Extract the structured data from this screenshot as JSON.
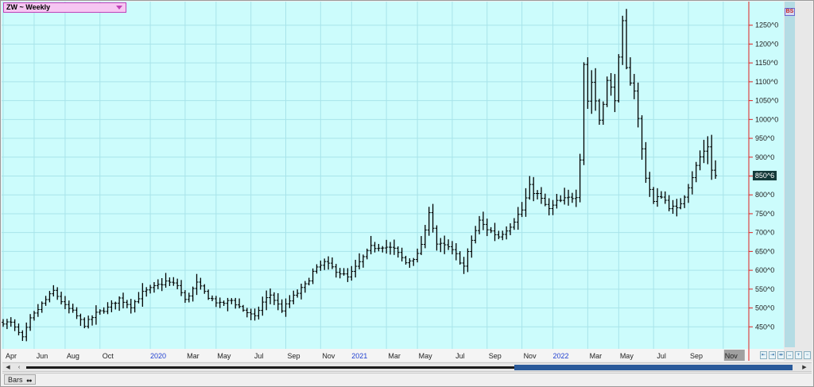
{
  "chart_header": {
    "title": "ZW ~ Weekly",
    "badge": "BS",
    "last_price_label": "850^6"
  },
  "status": {
    "tab_label": "Bars"
  },
  "nav_buttons": [
    "⇤",
    "⇥",
    "⇹",
    "↔",
    "+",
    "−"
  ],
  "colors": {
    "plot_bg": "#ccfcfc",
    "grid": "#a8e4ea",
    "bars": "#000000",
    "price_line": "#e02020",
    "price_tag": "#143a3a"
  },
  "chart_data": {
    "type": "ohlc-bar",
    "title": "ZW ~ Weekly",
    "period": "weekly",
    "ylim": [
      400,
      1300
    ],
    "yticks": [
      450,
      500,
      550,
      600,
      650,
      700,
      750,
      800,
      850,
      900,
      950,
      1000,
      1050,
      1100,
      1150,
      1200,
      1250
    ],
    "ytick_labels": [
      "450^0",
      "500^0",
      "550^0",
      "600^0",
      "650^0",
      "700^0",
      "750^0",
      "800^0",
      "850^0",
      "900^0",
      "950^0",
      "1000^0",
      "1050^0",
      "1100^0",
      "1150^0",
      "1200^0",
      "1250^0"
    ],
    "xticks": [
      {
        "label": "Apr",
        "i": 0
      },
      {
        "label": "Jun",
        "i": 8
      },
      {
        "label": "Aug",
        "i": 16
      },
      {
        "label": "Oct",
        "i": 25
      },
      {
        "label": "2020",
        "i": 38,
        "year": true
      },
      {
        "label": "Mar",
        "i": 47
      },
      {
        "label": "May",
        "i": 55
      },
      {
        "label": "Jul",
        "i": 64
      },
      {
        "label": "Sep",
        "i": 73
      },
      {
        "label": "Nov",
        "i": 82
      },
      {
        "label": "2021",
        "i": 90,
        "year": true
      },
      {
        "label": "Mar",
        "i": 99
      },
      {
        "label": "May",
        "i": 107
      },
      {
        "label": "Jul",
        "i": 116
      },
      {
        "label": "Sep",
        "i": 125
      },
      {
        "label": "Nov",
        "i": 134
      },
      {
        "label": "2022",
        "i": 142,
        "year": true
      },
      {
        "label": "Mar",
        "i": 151
      },
      {
        "label": "May",
        "i": 159
      },
      {
        "label": "Jul",
        "i": 168
      },
      {
        "label": "Sep",
        "i": 177
      },
      {
        "label": "Nov",
        "i": 186,
        "highlight": true
      }
    ],
    "last_price": 850.75,
    "close_points": [
      [
        0,
        462
      ],
      [
        2,
        460
      ],
      [
        5,
        420
      ],
      [
        7,
        470
      ],
      [
        10,
        510
      ],
      [
        13,
        545
      ],
      [
        16,
        505
      ],
      [
        18,
        490
      ],
      [
        21,
        455
      ],
      [
        24,
        485
      ],
      [
        27,
        500
      ],
      [
        30,
        525
      ],
      [
        33,
        505
      ],
      [
        36,
        540
      ],
      [
        39,
        555
      ],
      [
        42,
        570
      ],
      [
        45,
        560
      ],
      [
        47,
        520
      ],
      [
        50,
        565
      ],
      [
        53,
        530
      ],
      [
        56,
        510
      ],
      [
        59,
        520
      ],
      [
        62,
        495
      ],
      [
        65,
        475
      ],
      [
        67,
        515
      ],
      [
        69,
        535
      ],
      [
        72,
        495
      ],
      [
        75,
        530
      ],
      [
        78,
        560
      ],
      [
        80,
        595
      ],
      [
        83,
        620
      ],
      [
        86,
        600
      ],
      [
        89,
        580
      ],
      [
        92,
        620
      ],
      [
        95,
        660
      ],
      [
        98,
        665
      ],
      [
        101,
        655
      ],
      [
        104,
        620
      ],
      [
        107,
        640
      ],
      [
        109,
        700
      ],
      [
        110,
        760
      ],
      [
        112,
        670
      ],
      [
        115,
        660
      ],
      [
        117,
        640
      ],
      [
        119,
        610
      ],
      [
        121,
        680
      ],
      [
        123,
        730
      ],
      [
        125,
        710
      ],
      [
        128,
        690
      ],
      [
        131,
        720
      ],
      [
        134,
        760
      ],
      [
        136,
        820
      ],
      [
        138,
        800
      ],
      [
        141,
        760
      ],
      [
        143,
        780
      ],
      [
        146,
        790
      ],
      [
        148,
        800
      ],
      [
        149,
        900
      ],
      [
        150,
        1150
      ],
      [
        151,
        1050
      ],
      [
        152,
        1100
      ],
      [
        154,
        1000
      ],
      [
        156,
        1100
      ],
      [
        158,
        1060
      ],
      [
        160,
        1250
      ],
      [
        161,
        1130
      ],
      [
        163,
        1080
      ],
      [
        165,
        920
      ],
      [
        166,
        850
      ],
      [
        168,
        780
      ],
      [
        170,
        800
      ],
      [
        172,
        770
      ],
      [
        174,
        760
      ],
      [
        176,
        800
      ],
      [
        178,
        850
      ],
      [
        180,
        900
      ],
      [
        182,
        930
      ],
      [
        183,
        870
      ],
      [
        184,
        850
      ]
    ]
  }
}
